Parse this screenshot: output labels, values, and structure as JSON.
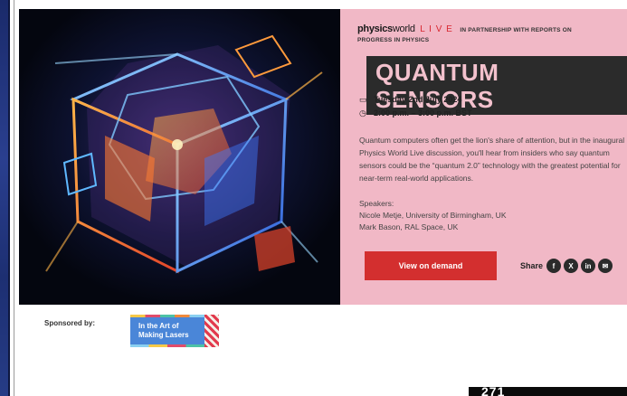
{
  "brand": {
    "physics": "physics",
    "world": "world",
    "live": "L I V E",
    "partnership": "IN PARTNERSHIP WITH REPORTS ON",
    "partnership_line2": "PROGRESS IN PHYSICS"
  },
  "event": {
    "title": "QUANTUM SENSORS",
    "date": "Tuesday 2nd July 2024",
    "time": "2:00 p.m. – 3:00 p.m. BST",
    "description": "Quantum computers often get the lion's share of attention, but in the inaugural Physics World Live discussion, you'll hear from insiders who say quantum sensors could be the “quantum 2.0” technology with the greatest potential for near-term real-world applications.",
    "speakers_label": "Speakers:",
    "speakers": [
      "Nicole Metje, University of Birmingham, UK",
      "Mark Bason, RAL Space, UK"
    ],
    "cta_label": "View on demand",
    "share_label": "Share",
    "social_icons": [
      "facebook-icon",
      "x-icon",
      "linkedin-icon",
      "email-icon"
    ]
  },
  "sponsor": {
    "label": "Sponsored by:",
    "logo_line1": "In the Art of",
    "logo_line2": "Making Lasers"
  },
  "page_number": "271",
  "colors": {
    "panel_bg": "#f1b8c6",
    "title_bg": "#2b2b2b",
    "title_text": "#f3c1cd",
    "cta_bg": "#d32f2f",
    "accent_red": "#d8262f"
  }
}
